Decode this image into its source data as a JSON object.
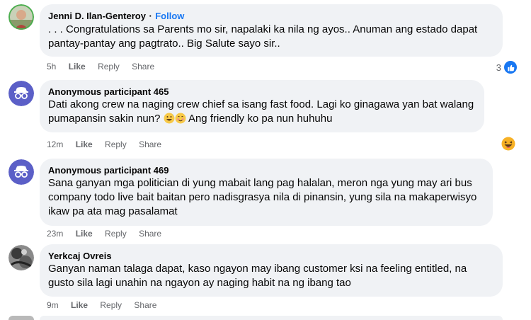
{
  "comments": [
    {
      "author": "Jenni D. Ilan-Genteroy",
      "follow_label": "Follow",
      "separator": "·",
      "text": ". . . Congratulations sa Parents mo sir, napalaki ka nila ng ayos.. Anuman ang estado dapat pantay-pantay ang pagtrato.. Big Salute sayo sir..",
      "time": "5h",
      "like_label": "Like",
      "reply_label": "Reply",
      "share_label": "Share",
      "reaction_count": "3",
      "reaction_icon": "like-icon"
    },
    {
      "author": "Anonymous participant 465",
      "text_before": "Dati akong crew na naging crew chief sa isang fast food. Lagi ko ginagawa yan bat walang pumapansin sakin nun? ",
      "text_after": " Ang friendly ko pa nun huhuhu",
      "time": "12m",
      "like_label": "Like",
      "reply_label": "Reply",
      "share_label": "Share",
      "reaction_icon": "haha-icon"
    },
    {
      "author": "Anonymous participant 469",
      "text": "Sana ganyan mga politician di yung mabait lang pag halalan, meron nga yung may ari bus company todo live bait baitan pero nadisgrasya nila di pinansin, yung sila na makaperwisyo ikaw pa ata mag pasalamat",
      "time": "23m",
      "like_label": "Like",
      "reply_label": "Reply",
      "share_label": "Share"
    },
    {
      "author": "Yerkcaj Ovreis",
      "text": "Ganyan naman talaga dapat, kaso ngayon may ibang customer ksi na feeling entitled, na gusto sila lagi unahin na ngayon ay naging habit na ng ibang tao",
      "time": "9m",
      "like_label": "Like",
      "reply_label": "Reply",
      "share_label": "Share"
    }
  ],
  "colors": {
    "bubble": "#f0f2f5",
    "accent": "#1877f2",
    "secondary_text": "#65676b",
    "anon_avatar": "#5b5fc7"
  }
}
